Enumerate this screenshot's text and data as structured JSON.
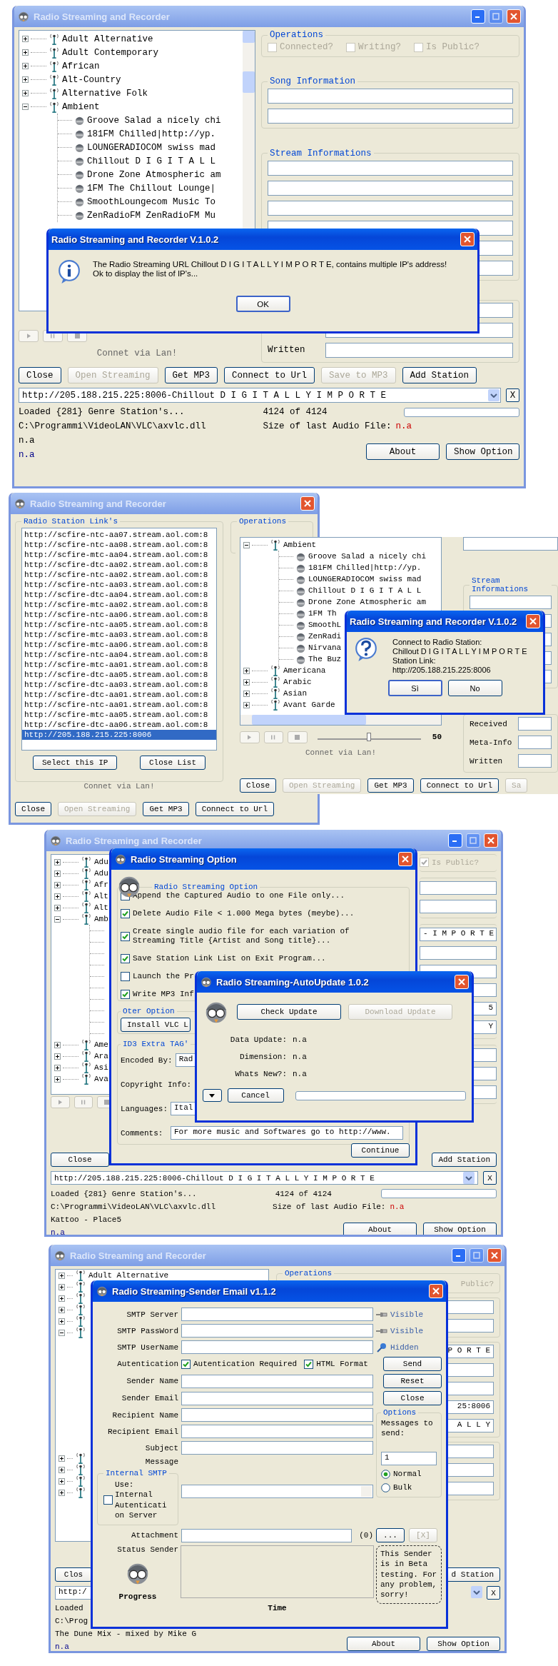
{
  "screen_1": {
    "main_window": {
      "title": "Radio Streaming and Recorder",
      "active": false,
      "tree": [
        {
          "label": "Adult Alternative",
          "expanded": false
        },
        {
          "label": "Adult Contemporary",
          "expanded": false
        },
        {
          "label": "African",
          "expanded": false
        },
        {
          "label": "Alt-Country",
          "expanded": false
        },
        {
          "label": "Alternative Folk",
          "expanded": false
        },
        {
          "label": "Ambient",
          "expanded": true,
          "children": [
            {
              "label": "Groove Salad a nicely chi"
            },
            {
              "label": "181FM  Chilled|http://yp."
            },
            {
              "label": "LOUNGERADIOCOM  swiss mad"
            },
            {
              "label": "Chillout  D I G I T A L L"
            },
            {
              "label": "Drone Zone Atmospheric am"
            },
            {
              "label": "1FM  The Chillout Lounge|"
            },
            {
              "label": "SmoothLoungecom  Music To"
            },
            {
              "label": "ZenRadioFM ZenRadioFM  Mu"
            }
          ]
        }
      ],
      "operations": {
        "title": "Operations",
        "checks": [
          {
            "label": "Connected?",
            "checked": false
          },
          {
            "label": "Writing?",
            "checked": false
          },
          {
            "label": "Is Public?",
            "checked": false
          }
        ]
      },
      "song_information": "Song Information",
      "stream_informations": "Stream Informations",
      "connection_status": "Connet via Lan!",
      "written_label": "Written",
      "buttons": [
        {
          "label": "Close",
          "disabled": false
        },
        {
          "label": "Open Streaming",
          "disabled": true
        },
        {
          "label": "Get MP3",
          "disabled": false
        },
        {
          "label": "Connect to Url",
          "disabled": false
        },
        {
          "label": "Save to MP3",
          "disabled": true
        },
        {
          "label": "Add Station",
          "disabled": false
        }
      ],
      "url_combo": {
        "value": "http://205.188.215.225:8006-Chillout  D I G I T A L L Y  I M P O R T E",
        "clear": "X"
      },
      "status": {
        "loaded": "Loaded {281} Genre Station's...",
        "count": "4124 of 4124",
        "progress": {
          "level": 0
        },
        "path": "C:\\Programmi\\VideoLAN\\VLC\\axvlc.dll",
        "size_label": "Size of last Audio File:",
        "size_value": "n.a",
        "now_playing": "n.a",
        "info": "n.a"
      },
      "bottom_buttons": [
        "About",
        "Show Option"
      ]
    },
    "message_box": {
      "title": "Radio Streaming and Recorder V.1.0.2",
      "active": true,
      "kind": "info",
      "lines": [
        "The Radio Streaming URL Chillout D I G I T A L L Y I M P O R T E, contains multiple IP's address!",
        "Ok to display the list of IP's..."
      ],
      "buttons": [
        "OK"
      ]
    }
  },
  "screen_2": {
    "main_window": {
      "title": "Radio Streaming and Recorder",
      "active": false,
      "links_group": {
        "title": "Radio Station Link's",
        "links": [
          {
            "url": "http://scfire-ntc-aa07.stream.aol.com:8",
            "selected": false
          },
          {
            "url": "http://scfire-ntc-aa08.stream.aol.com:8",
            "selected": false
          },
          {
            "url": "http://scfire-mtc-aa04.stream.aol.com:8",
            "selected": false
          },
          {
            "url": "http://scfire-dtc-aa02.stream.aol.com:8",
            "selected": false
          },
          {
            "url": "http://scfire-ntc-aa02.stream.aol.com:8",
            "selected": false
          },
          {
            "url": "http://scfire-ntc-aa03.stream.aol.com:8",
            "selected": false
          },
          {
            "url": "http://scfire-dtc-aa04.stream.aol.com:8",
            "selected": false
          },
          {
            "url": "http://scfire-mtc-aa02.stream.aol.com:8",
            "selected": false
          },
          {
            "url": "http://scfire-ntc-aa06.stream.aol.com:8",
            "selected": false
          },
          {
            "url": "http://scfire-ntc-aa05.stream.aol.com:8",
            "selected": false
          },
          {
            "url": "http://scfire-mtc-aa03.stream.aol.com:8",
            "selected": false
          },
          {
            "url": "http://scfire-mtc-aa06.stream.aol.com:8",
            "selected": false
          },
          {
            "url": "http://scfire-ntc-aa04.stream.aol.com:8",
            "selected": false
          },
          {
            "url": "http://scfire-mtc-aa01.stream.aol.com:8",
            "selected": false
          },
          {
            "url": "http://scfire-dtc-aa05.stream.aol.com:8",
            "selected": false
          },
          {
            "url": "http://scfire-dtc-aa03.stream.aol.com:8",
            "selected": false
          },
          {
            "url": "http://scfire-dtc-aa01.stream.aol.com:8",
            "selected": false
          },
          {
            "url": "http://scfire-ntc-aa01.stream.aol.com:8",
            "selected": false
          },
          {
            "url": "http://scfire-mtc-aa05.stream.aol.com:8",
            "selected": false
          },
          {
            "url": "http://scfire-dtc-aa06.stream.aol.com:8",
            "selected": false
          },
          {
            "url": "http://205.188.215.225:8006",
            "selected": true
          }
        ],
        "buttons": [
          "Select this IP",
          "Close List"
        ]
      },
      "operations_title": "Operations",
      "connection_status": "Connet via Lan!",
      "buttons": [
        {
          "label": "Close",
          "disabled": false
        },
        {
          "label": "Open Streaming",
          "disabled": true
        },
        {
          "label": "Get MP3",
          "disabled": false
        },
        {
          "label": "Connect to Url",
          "disabled": false
        }
      ]
    },
    "background_window": {
      "tree": [
        {
          "label": "Ambient",
          "expanded": true,
          "children": [
            {
              "label": "Groove Salad a nicely chi"
            },
            {
              "label": "181FM  Chilled|http://yp."
            },
            {
              "label": "LOUNGERADIOCOM  swiss mad"
            },
            {
              "label": "Chillout  D I G I T A L L"
            },
            {
              "label": "Drone Zone Atmospheric am"
            },
            {
              "label": "1FM  Th"
            },
            {
              "label": "SmoothL"
            },
            {
              "label": "ZenRadi"
            },
            {
              "label": "Nirvana"
            },
            {
              "label": "The Buz"
            }
          ]
        },
        {
          "label": "Americana",
          "expanded": false
        },
        {
          "label": "Arabic",
          "expanded": false
        },
        {
          "label": "Asian",
          "expanded": false
        },
        {
          "label": "Avant Garde",
          "expanded": false
        }
      ],
      "player": {
        "level": 0.5,
        "reading": "50"
      },
      "connection_status": "Connet via Lan!",
      "stream_informations": "Stream Informations",
      "stats": [
        "Received",
        "Meta-Info",
        "Written"
      ],
      "buttons": [
        {
          "label": "Close",
          "disabled": false
        },
        {
          "label": "Open Streaming",
          "disabled": true
        },
        {
          "label": "Get MP3",
          "disabled": false
        },
        {
          "label": "Connect to Url",
          "disabled": false
        },
        {
          "label": "Sa",
          "disabled": true
        }
      ]
    },
    "question_box": {
      "title": "Radio Streaming and Recorder V.1.0.2",
      "active": true,
      "kind": "question",
      "lines": [
        "Connect to Radio Station:",
        "Chillout D I G I T A L L Y I M P O R T E",
        "Station Link:",
        "http://205.188.215.225:8006"
      ],
      "buttons": [
        "Sì",
        "No"
      ]
    }
  },
  "screen_3": {
    "main_window": {
      "title": "Radio Streaming and Recorder",
      "active": false,
      "tree": [
        {
          "label": "Adu",
          "expanded": false
        },
        {
          "label": "Adu",
          "expanded": false
        },
        {
          "label": "Afr",
          "expanded": false
        },
        {
          "label": "Alt",
          "expanded": false
        },
        {
          "label": "Alt",
          "expanded": false
        },
        {
          "label": "Amb",
          "expanded": true
        },
        {
          "label": "Ame",
          "expanded": false
        },
        {
          "label": "Ara",
          "expanded": false
        },
        {
          "label": "Asi",
          "expanded": false
        },
        {
          "label": "Ava",
          "expanded": false
        }
      ],
      "public_check": {
        "label": "Is Public?",
        "checked": true
      },
      "field_texts": [
        "- I M P O R T E",
        "5",
        "Y"
      ],
      "close_button": "Close",
      "add_station": "Add Station",
      "url_combo": {
        "value": "http://205.188.215.225:8006-Chillout  D I G I T A L L Y  I M P O R T E",
        "clear": "X"
      },
      "status": {
        "loaded": "Loaded {281} Genre Station's...",
        "count": "4124 of 4124",
        "progress": {
          "level": 0
        },
        "path": "C:\\Programmi\\VideoLAN\\VLC\\axvlc.dll",
        "size_label": "Size of last Audio File:",
        "size_value": "n.a",
        "now_playing": "Kattoo - Place5",
        "info": "n.a"
      },
      "bottom_buttons": [
        "About",
        "Show Option"
      ]
    },
    "option_dialog": {
      "title": "Radio Streaming Option",
      "active": true,
      "group_title": "Radio Streaming Option",
      "options": [
        {
          "label": "Append the Captured Audio to one File only...",
          "checked": false
        },
        {
          "label": "Delete Audio File < 1.000 Mega bytes (meybe)...",
          "checked": true
        },
        {
          "label": "Create single audio file for each variation of Streaming Title {Artist and Song title}...",
          "checked": true
        },
        {
          "label": "Save Station Link List on Exit Program...",
          "checked": true
        },
        {
          "label": "Launch the Pr",
          "checked": false
        },
        {
          "label": "Write MP3 Inf",
          "checked": true
        }
      ],
      "other_title": "Oter Option",
      "install_button": "Install VLC L",
      "id3_title": "ID3 Extra TAG'",
      "id3_fields": [
        {
          "label": "Encoded By:",
          "value": "Rad"
        },
        {
          "label": "Copyright Info:"
        },
        {
          "label": "Languages:",
          "value": "Ital"
        },
        {
          "label": "Comments:",
          "value": "For more music and Softwares go to http://www."
        }
      ],
      "continue_button": "Continue"
    },
    "update_dialog": {
      "title": "Radio Streaming-AutoUpdate 1.0.2",
      "active": true,
      "buttons": [
        {
          "label": "Check Update",
          "disabled": false
        },
        {
          "label": "Download Update",
          "disabled": true
        }
      ],
      "rows": [
        {
          "label": "Data Update:",
          "value": "n.a"
        },
        {
          "label": "Dimension:",
          "value": "n.a"
        },
        {
          "label": "Whats New?:",
          "value": "n.a"
        }
      ],
      "cancel_button": "Cancel",
      "progress": {
        "level": 0
      }
    }
  },
  "screen_4": {
    "main_window": {
      "title": "Radio Streaming and Recorder",
      "active": false,
      "tree": [
        {
          "label": "Adult Alternative",
          "expanded": false
        },
        {
          "expanded": false
        },
        {
          "expanded": false
        },
        {
          "expanded": false
        },
        {
          "expanded": false
        },
        {
          "expanded": true
        },
        {
          "expanded": false
        },
        {
          "expanded": false
        },
        {
          "expanded": false
        },
        {
          "expanded": false
        }
      ],
      "operations_title": "Operations",
      "public_label": "Public?",
      "field_texts": [
        "P O R T E",
        "25:8006",
        "A L L Y"
      ],
      "close_button": "Clos",
      "add_station": "d Station",
      "url_combo": "http:/",
      "status": {
        "loaded": "Loaded",
        "path": "C:\\Prog",
        "now_playing": "The Dune Mix - mixed by Mike G",
        "info": "n.a"
      },
      "clear": "X",
      "bottom_buttons": [
        "About",
        "Show Option"
      ]
    },
    "email_dialog": {
      "title": "Radio Streaming-Sender Email v1.1.2",
      "active": true,
      "smtp_fields": [
        {
          "label": "SMTP Server",
          "visibility": "Visible",
          "pinned": false
        },
        {
          "label": "SMTP PassWord",
          "visibility": "Visible",
          "pinned": false
        },
        {
          "label": "SMTP UserName",
          "visibility": "Hidden",
          "pinned": true
        }
      ],
      "auth_label": "Autentication",
      "auth_checks": [
        {
          "label": "Autentication Required",
          "checked": true
        },
        {
          "label": "HTML Format",
          "checked": true
        }
      ],
      "actions": [
        "Send",
        "Reset",
        "Close"
      ],
      "fields": [
        "Sender Name",
        "Sender Email",
        "Recipient Name",
        "Recipient Email",
        "Subject"
      ],
      "message_label": "Message",
      "internal_smtp": {
        "title": "Internal SMTP",
        "label": "Use: Internal Autenticati on Server",
        "checked": false
      },
      "options": {
        "title": "Options",
        "messages_label": "Messages to send:",
        "count": "1",
        "modes": [
          {
            "label": "Normal",
            "selected": true
          },
          {
            "label": "Bulk",
            "selected": false
          }
        ]
      },
      "attachment_label": "Attachment",
      "attachment_count": "(0)",
      "browse_button": "...",
      "remove_button": {
        "label": "[X]",
        "disabled": true
      },
      "status_label": "Status Sender",
      "note": "This Sender is in Beta testing. For any problem, sorry!",
      "progress_label": "Progress",
      "time_label": "Time"
    }
  }
}
